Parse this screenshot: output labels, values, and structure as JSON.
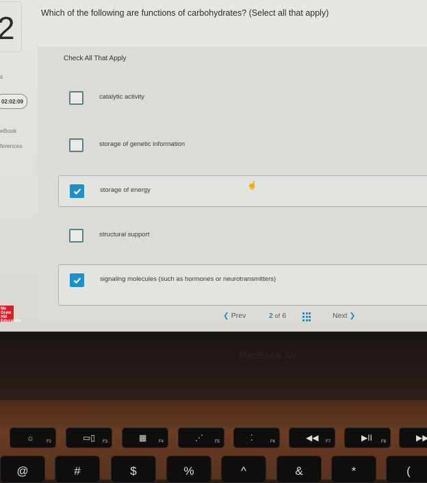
{
  "question": {
    "number": "2",
    "text": "Which of the following are functions of carbohydrates? (Select all that apply)",
    "instruction": "Check All That Apply",
    "options": [
      {
        "label": "catalytic activity",
        "checked": false
      },
      {
        "label": "storage of genetic information",
        "checked": false
      },
      {
        "label": "storage of energy",
        "checked": true
      },
      {
        "label": "structural support",
        "checked": false
      },
      {
        "label": "signaling molecules (such as hormones or neurotransmitters)",
        "checked": true
      }
    ]
  },
  "sidebar": {
    "partial_label": "s",
    "timer": "02:02:09",
    "ebook_label": "eBook",
    "references_label": "ferences"
  },
  "logo": {
    "text": "Mc Graw Hill Education",
    "color": "#d3212a"
  },
  "pager": {
    "prev_label": "Prev",
    "current": "2",
    "of_label": "of",
    "total": "6",
    "next_label": "Next"
  },
  "accent_color": "#1f8fc7",
  "device": {
    "brand": "MacBook Air"
  },
  "keyboard": {
    "fkeys": [
      {
        "glyph": "☼",
        "label": "F2"
      },
      {
        "glyph": "▭▯",
        "label": "F3"
      },
      {
        "glyph": "▦",
        "label": "F4"
      },
      {
        "glyph": "⋰",
        "label": "F5"
      },
      {
        "glyph": "⁚",
        "label": "F6"
      },
      {
        "glyph": "◀◀",
        "label": "F7"
      },
      {
        "glyph": "▶II",
        "label": "F8"
      },
      {
        "glyph": "▶▶",
        "label": ""
      }
    ],
    "numkeys": [
      "@",
      "#",
      "$",
      "%",
      "^",
      "&",
      "*",
      "("
    ]
  }
}
